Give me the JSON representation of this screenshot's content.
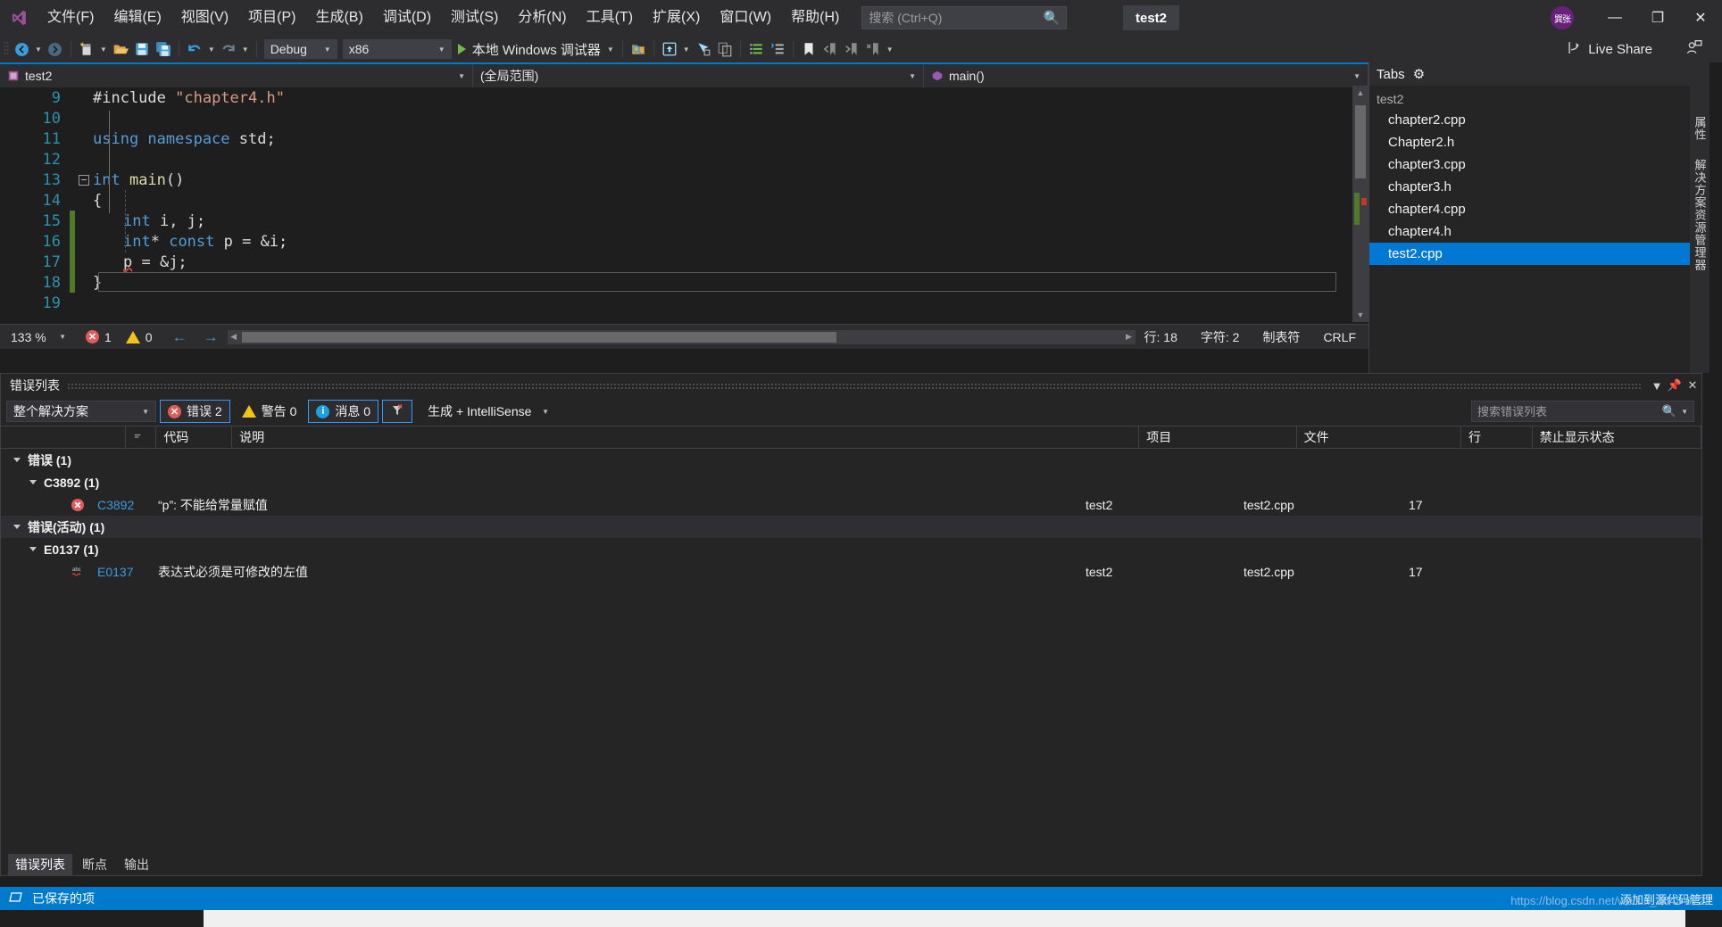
{
  "titlebar": {
    "menus": [
      "文件(F)",
      "编辑(E)",
      "视图(V)",
      "项目(P)",
      "生成(B)",
      "调试(D)",
      "测试(S)",
      "分析(N)",
      "工具(T)",
      "扩展(X)",
      "窗口(W)",
      "帮助(H)"
    ],
    "search_placeholder": "搜索 (Ctrl+Q)",
    "search_value": "",
    "project_name": "test2",
    "avatar_text": "巽张",
    "minimize": "—",
    "maximize": "❐",
    "close": "✕"
  },
  "toolbar": {
    "config": "Debug",
    "platform": "x86",
    "run_label": "本地 Windows 调试器",
    "live_share": "Live Share"
  },
  "navbar": {
    "project": "test2",
    "scope": "(全局范围)",
    "member": "main()"
  },
  "editor": {
    "lines": [
      {
        "num": "9",
        "modified": false,
        "fold": "none",
        "indent": 0,
        "tokens": [
          {
            "t": "#include ",
            "c": "pp"
          },
          {
            "t": "\"chapter4.h\"",
            "c": "str"
          }
        ]
      },
      {
        "num": "10",
        "modified": false,
        "fold": "none",
        "indent": 0,
        "tokens": []
      },
      {
        "num": "11",
        "modified": false,
        "fold": "none",
        "indent": 0,
        "tokens": [
          {
            "t": "using namespace ",
            "c": "k"
          },
          {
            "t": "std;",
            "c": "pl"
          }
        ]
      },
      {
        "num": "12",
        "modified": false,
        "fold": "none",
        "indent": 0,
        "tokens": []
      },
      {
        "num": "13",
        "modified": false,
        "fold": "minus",
        "indent": 0,
        "tokens": [
          {
            "t": "int ",
            "c": "k"
          },
          {
            "t": "main",
            "c": "fn"
          },
          {
            "t": "()",
            "c": "pl"
          }
        ]
      },
      {
        "num": "14",
        "modified": false,
        "fold": "none",
        "indent": 0,
        "tokens": [
          {
            "t": "{",
            "c": "pl"
          }
        ]
      },
      {
        "num": "15",
        "modified": true,
        "fold": "none",
        "indent": 1,
        "tokens": [
          {
            "t": "int",
            "c": "k"
          },
          {
            "t": " i, j;",
            "c": "pl"
          }
        ]
      },
      {
        "num": "16",
        "modified": true,
        "fold": "none",
        "indent": 1,
        "tokens": [
          {
            "t": "int",
            "c": "k"
          },
          {
            "t": "* ",
            "c": "pl"
          },
          {
            "t": "const",
            "c": "k"
          },
          {
            "t": " p = &i;",
            "c": "pl"
          }
        ]
      },
      {
        "num": "17",
        "modified": true,
        "fold": "none",
        "indent": 1,
        "tokens": [
          {
            "t": "p",
            "c": "sq"
          },
          {
            "t": " = &j;",
            "c": "pl"
          }
        ]
      },
      {
        "num": "18",
        "modified": true,
        "fold": "none",
        "indent": 0,
        "tokens": [
          {
            "t": "}",
            "c": "pl"
          }
        ]
      },
      {
        "num": "19",
        "modified": false,
        "fold": "none",
        "indent": 0,
        "tokens": []
      }
    ],
    "zoom": "133 %",
    "error_count": "1",
    "warning_count": "0",
    "line_label": "行: 18",
    "char_label": "字符: 2",
    "tab_label": "制表符",
    "eol_label": "CRLF"
  },
  "tabs_panel": {
    "title": "Tabs",
    "root": "test2",
    "items": [
      {
        "label": "chapter2.cpp",
        "selected": false
      },
      {
        "label": "Chapter2.h",
        "selected": false
      },
      {
        "label": "chapter3.cpp",
        "selected": false
      },
      {
        "label": "chapter3.h",
        "selected": false
      },
      {
        "label": "chapter4.cpp",
        "selected": false
      },
      {
        "label": "chapter4.h",
        "selected": false
      },
      {
        "label": "test2.cpp",
        "selected": true
      }
    ]
  },
  "rail": {
    "tabs": [
      "属性",
      "解决方案资源管理器"
    ]
  },
  "errorlist": {
    "title": "错误列表",
    "filter_scope": "整个解决方案",
    "errors_label": "错误 2",
    "warnings_label": "警告 0",
    "messages_label": "消息 0",
    "build_filter": "生成 + IntelliSense",
    "search_placeholder": "搜索错误列表",
    "search_value": "",
    "columns": [
      "",
      "代码",
      "说明",
      "项目",
      "文件",
      "行",
      "禁止显示状态"
    ],
    "rows": [
      {
        "kind": "group1",
        "text": "错误 (1)"
      },
      {
        "kind": "group2",
        "text": "C3892 (1)"
      },
      {
        "kind": "item",
        "icon": "error-icon",
        "code": "C3892",
        "desc": "“p”: 不能给常量赋值",
        "project": "test2",
        "file": "test2.cpp",
        "line": "17",
        "suppression": ""
      },
      {
        "kind": "group1sel",
        "text": "错误(活动) (1)"
      },
      {
        "kind": "group2",
        "text": "E0137 (1)"
      },
      {
        "kind": "item",
        "icon": "squiggle-icon",
        "code": "E0137",
        "desc": "表达式必须是可修改的左值",
        "project": "test2",
        "file": "test2.cpp",
        "line": "17",
        "suppression": ""
      }
    ],
    "bottom_tabs": [
      {
        "label": "错误列表",
        "active": true
      },
      {
        "label": "断点",
        "active": false
      },
      {
        "label": "输出",
        "active": false
      }
    ]
  },
  "statusbar": {
    "message": "已保存的项",
    "watermark": "https://blog.csdn.net/weixin_3645 9722",
    "notice": "添加到源代码管理"
  }
}
